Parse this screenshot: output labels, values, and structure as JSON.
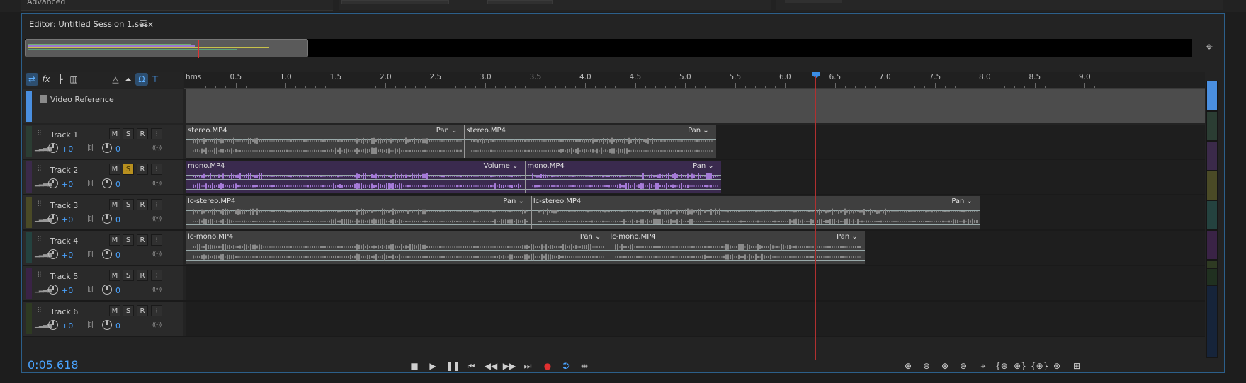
{
  "top": {
    "advanced_label": "Advanced"
  },
  "editor": {
    "title": "Editor: Untitled Session 1.sesx",
    "menu_icon": "hamburger-icon"
  },
  "ruler": {
    "unit_label": "hms",
    "labels": [
      "0.5",
      "1.0",
      "1.5",
      "2.0",
      "2.5",
      "3.0",
      "3.5",
      "4.0",
      "4.5",
      "5.0",
      "5.5",
      "6.0",
      "6.5",
      "7.0",
      "7.5",
      "8.0",
      "8.5",
      "9.0"
    ],
    "max_seconds": 9.1
  },
  "playhead_seconds": 5.618,
  "video_track": {
    "name": "Video Reference",
    "color": "#4a8fe0"
  },
  "track_buttons": {
    "mute": "M",
    "solo": "S",
    "record": "R"
  },
  "tracks": [
    {
      "name": "Track 1",
      "volume": "+0",
      "pan": "0",
      "stripe": "#2b3d33",
      "clips": [
        {
          "name": "stereo.MP4",
          "env": "Pan",
          "start": 0.0,
          "end": 2.79,
          "color": "#3f3f3f",
          "wave": "#8a8a8a"
        },
        {
          "name": "stereo.MP4",
          "env": "Pan",
          "start": 2.79,
          "end": 5.31,
          "color": "#3f3f3f",
          "wave": "#8a8a8a"
        }
      ]
    },
    {
      "name": "Track 2",
      "volume": "+0",
      "pan": "0",
      "solo": true,
      "stripe": "#3b2a4a",
      "clips": [
        {
          "name": "mono.MP4",
          "env": "Volume",
          "start": 0.0,
          "end": 3.4,
          "color": "#3a2a4e",
          "wave": "#a57ad8"
        },
        {
          "name": "mono.MP4",
          "env": "Pan",
          "start": 3.4,
          "end": 5.36,
          "color": "#3a2a4e",
          "wave": "#a57ad8"
        }
      ]
    },
    {
      "name": "Track 3",
      "volume": "+0",
      "pan": "0",
      "stripe": "#4a4a26",
      "clips": [
        {
          "name": "lc-stereo.MP4",
          "env": "Pan",
          "start": 0.0,
          "end": 3.46,
          "color": "#3f3f3f",
          "wave": "#8a8a8a"
        },
        {
          "name": "lc-stereo.MP4",
          "env": "Pan",
          "start": 3.46,
          "end": 7.95,
          "color": "#3f3f3f",
          "wave": "#8a8a8a"
        }
      ]
    },
    {
      "name": "Track 4",
      "volume": "+0",
      "pan": "0",
      "stripe": "#24423f",
      "clips": [
        {
          "name": "lc-mono.MP4",
          "env": "Pan",
          "start": 0.0,
          "end": 4.23,
          "color": "#3f3f3f",
          "wave": "#8a8a8a"
        },
        {
          "name": "lc-mono.MP4",
          "env": "Pan",
          "start": 4.23,
          "end": 6.8,
          "color": "#3f3f3f",
          "wave": "#8a8a8a"
        }
      ]
    },
    {
      "name": "Track 5",
      "volume": "+0",
      "pan": "0",
      "stripe": "#3a2346",
      "clips": []
    },
    {
      "name": "Track 6",
      "volume": "+0",
      "pan": "0",
      "stripe": "#2e3a22",
      "clips": []
    }
  ],
  "transport": {
    "time": "0:05.618"
  }
}
